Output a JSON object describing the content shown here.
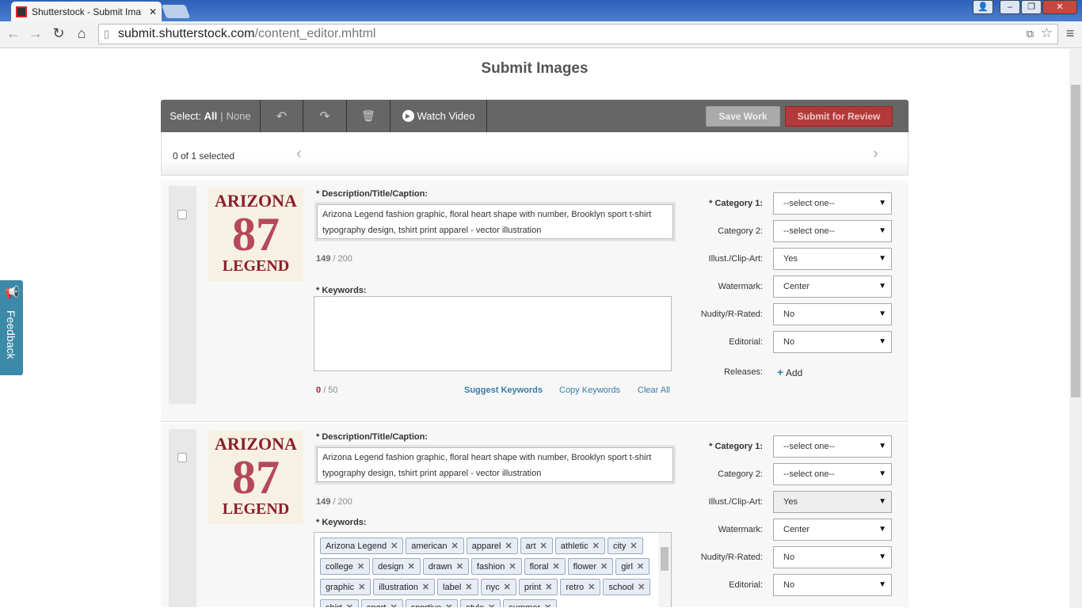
{
  "browser": {
    "tab_title": "Shutterstock - Submit Ima",
    "url_domain": "submit.shutterstock.com",
    "url_path": "/content_editor.mhtml"
  },
  "page": {
    "title": "Submit Images"
  },
  "toolbar": {
    "select_label": "Select:",
    "all": "All",
    "none": "None",
    "watch_video": "Watch Video",
    "save": "Save Work",
    "submit": "Submit for Review",
    "selected_status": "0 of 1 selected"
  },
  "feedback": "Feedback",
  "labels": {
    "description": "* Description/Title/Caption:",
    "keywords": "* Keywords:",
    "suggest": "Suggest Keywords",
    "copy": "Copy Keywords",
    "clear": "Clear All",
    "category1": "* Category 1:",
    "category2": "Category 2:",
    "illust": "Illust./Clip-Art:",
    "watermark": "Watermark:",
    "nudity": "Nudity/R-Rated:",
    "editorial": "Editorial:",
    "releases": "Releases:",
    "add": "Add",
    "kw_max": "/ 50",
    "desc_max": "/ 200"
  },
  "thumb": {
    "line1": "ARIZONA",
    "line2": "87",
    "line3": "LEGEND"
  },
  "items": [
    {
      "description": "Arizona Legend fashion graphic, floral heart shape with number, Brooklyn sport t-shirt typography design, tshirt print apparel  - vector illustration",
      "desc_count": "149",
      "kw_count": "0",
      "category1": "--select one--",
      "category2": "--select one--",
      "illust": "Yes",
      "watermark": "Center",
      "nudity": "No",
      "editorial": "No",
      "keywords": []
    },
    {
      "description": "Arizona Legend fashion graphic, floral heart shape with number, Brooklyn sport t-shirt typography design, tshirt print apparel  - vector illustration",
      "desc_count": "149",
      "category1": "--select one--",
      "category2": "--select one--",
      "illust": "Yes",
      "watermark": "Center",
      "nudity": "No",
      "editorial": "No",
      "keywords": [
        "Arizona Legend",
        "american",
        "apparel",
        "art",
        "athletic",
        "city",
        "college",
        "design",
        "drawn",
        "fashion",
        "floral",
        "flower",
        "girl",
        "graphic",
        "illustration",
        "label",
        "nyc",
        "print",
        "retro",
        "school",
        "shirt",
        "sport",
        "sportive",
        "style",
        "summer"
      ]
    }
  ]
}
